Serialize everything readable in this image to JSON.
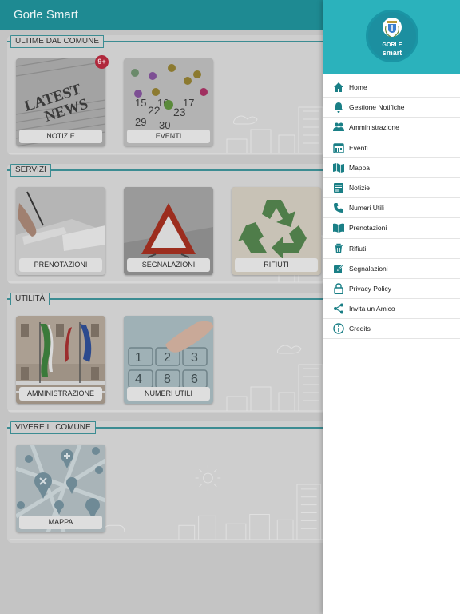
{
  "app": {
    "title": "Gorle Smart"
  },
  "colors": {
    "appbar": "#1e8a92",
    "drawer_header": "#2bb2bc",
    "menu_icon": "#1a7f86",
    "badge": "#b0283c"
  },
  "sections": [
    {
      "title": "ULTIME DAL COMUNE",
      "tiles": [
        {
          "label": "NOTIZIE",
          "image": "newspaper-latest-news",
          "badge": "9+"
        },
        {
          "label": "EVENTI",
          "image": "calendar-pins"
        }
      ]
    },
    {
      "title": "SERVIZI",
      "tiles": [
        {
          "label": "PRENOTAZIONI",
          "image": "hand-writing-notebook"
        },
        {
          "label": "SEGNALAZIONI",
          "image": "warning-triangle-road"
        },
        {
          "label": "RIFIUTI",
          "image": "recycle-symbol"
        }
      ]
    },
    {
      "title": "UTILITÀ",
      "tiles": [
        {
          "label": "AMMINISTRAZIONE",
          "image": "town-hall-flags"
        },
        {
          "label": "NUMERI UTILI",
          "image": "phone-keypad-finger"
        }
      ]
    },
    {
      "title": "VIVERE IL COMUNE",
      "tiles": [
        {
          "label": "MAPPA",
          "image": "map-with-pins"
        }
      ]
    }
  ],
  "drawer": {
    "logo": {
      "line1": "GORLE",
      "line2": "smart",
      "icon": "coat-of-arms-icon"
    },
    "menu": [
      {
        "label": "Home",
        "icon": "home-icon"
      },
      {
        "label": "Gestione Notifiche",
        "icon": "bell-icon"
      },
      {
        "label": "Amministrazione",
        "icon": "people-icon"
      },
      {
        "label": "Eventi",
        "icon": "calendar-icon"
      },
      {
        "label": "Mappa",
        "icon": "map-icon"
      },
      {
        "label": "Notizie",
        "icon": "newspaper-icon"
      },
      {
        "label": "Numeri Utili",
        "icon": "phone-icon"
      },
      {
        "label": "Prenotazioni",
        "icon": "book-icon"
      },
      {
        "label": "Rifiuti",
        "icon": "trash-icon"
      },
      {
        "label": "Segnalazioni",
        "icon": "edit-icon"
      },
      {
        "label": "Privacy Policy",
        "icon": "lock-icon"
      },
      {
        "label": "Invita un Amico",
        "icon": "share-icon"
      },
      {
        "label": "Credits",
        "icon": "info-icon"
      }
    ]
  }
}
